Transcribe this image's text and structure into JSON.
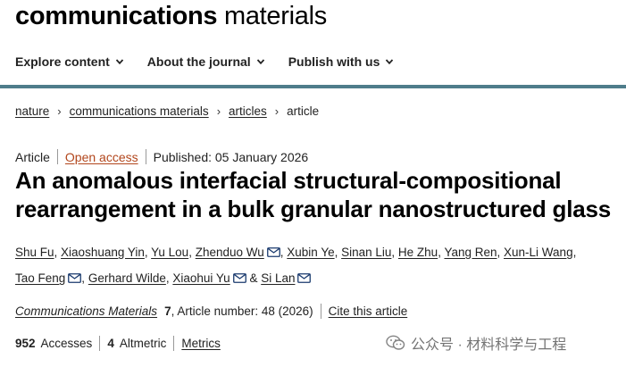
{
  "brand": {
    "bold": "communications",
    "light": " materials"
  },
  "nav": {
    "items": [
      {
        "label": "Explore content"
      },
      {
        "label": "About the journal"
      },
      {
        "label": "Publish with us"
      }
    ]
  },
  "breadcrumb": {
    "items": [
      "nature",
      "communications materials",
      "articles"
    ],
    "current": "article",
    "separator": "›"
  },
  "article_meta": {
    "type": "Article",
    "access": "Open access",
    "published": "Published: 05 January 2026"
  },
  "title": "An anomalous interfacial structural-compositional rearrangement in a bulk granular nanostructured glass",
  "authors": [
    {
      "name": "Shu Fu",
      "email": false
    },
    {
      "name": "Xiaoshuang Yin",
      "email": false
    },
    {
      "name": "Yu Lou",
      "email": false
    },
    {
      "name": "Zhenduo Wu",
      "email": true
    },
    {
      "name": "Xubin Ye",
      "email": false
    },
    {
      "name": "Sinan Liu",
      "email": false
    },
    {
      "name": "He Zhu",
      "email": false
    },
    {
      "name": "Yang Ren",
      "email": false
    },
    {
      "name": "Xun-Li Wang",
      "email": false
    },
    {
      "name": "Tao Feng",
      "email": true
    },
    {
      "name": "Gerhard Wilde",
      "email": false
    },
    {
      "name": "Xiaohui Yu",
      "email": true
    },
    {
      "name": "Si Lan",
      "email": true
    }
  ],
  "author_separator": ", ",
  "author_last_separator": " & ",
  "citation": {
    "journal": "Communications Materials",
    "volume": "7",
    "article_number": ", Article number: 48 (2026)",
    "cite_link": "Cite this article"
  },
  "metrics": {
    "accesses_count": "952",
    "accesses_label": "Accesses",
    "altmetric_count": "4",
    "altmetric_label": "Altmetric",
    "metrics_link": "Metrics"
  },
  "watermark": {
    "text": "公众号 · 材料科学与工程",
    "icon": "wechat-icon"
  },
  "colors": {
    "band": "#4f7d8b",
    "open_access": "#b2461c"
  }
}
